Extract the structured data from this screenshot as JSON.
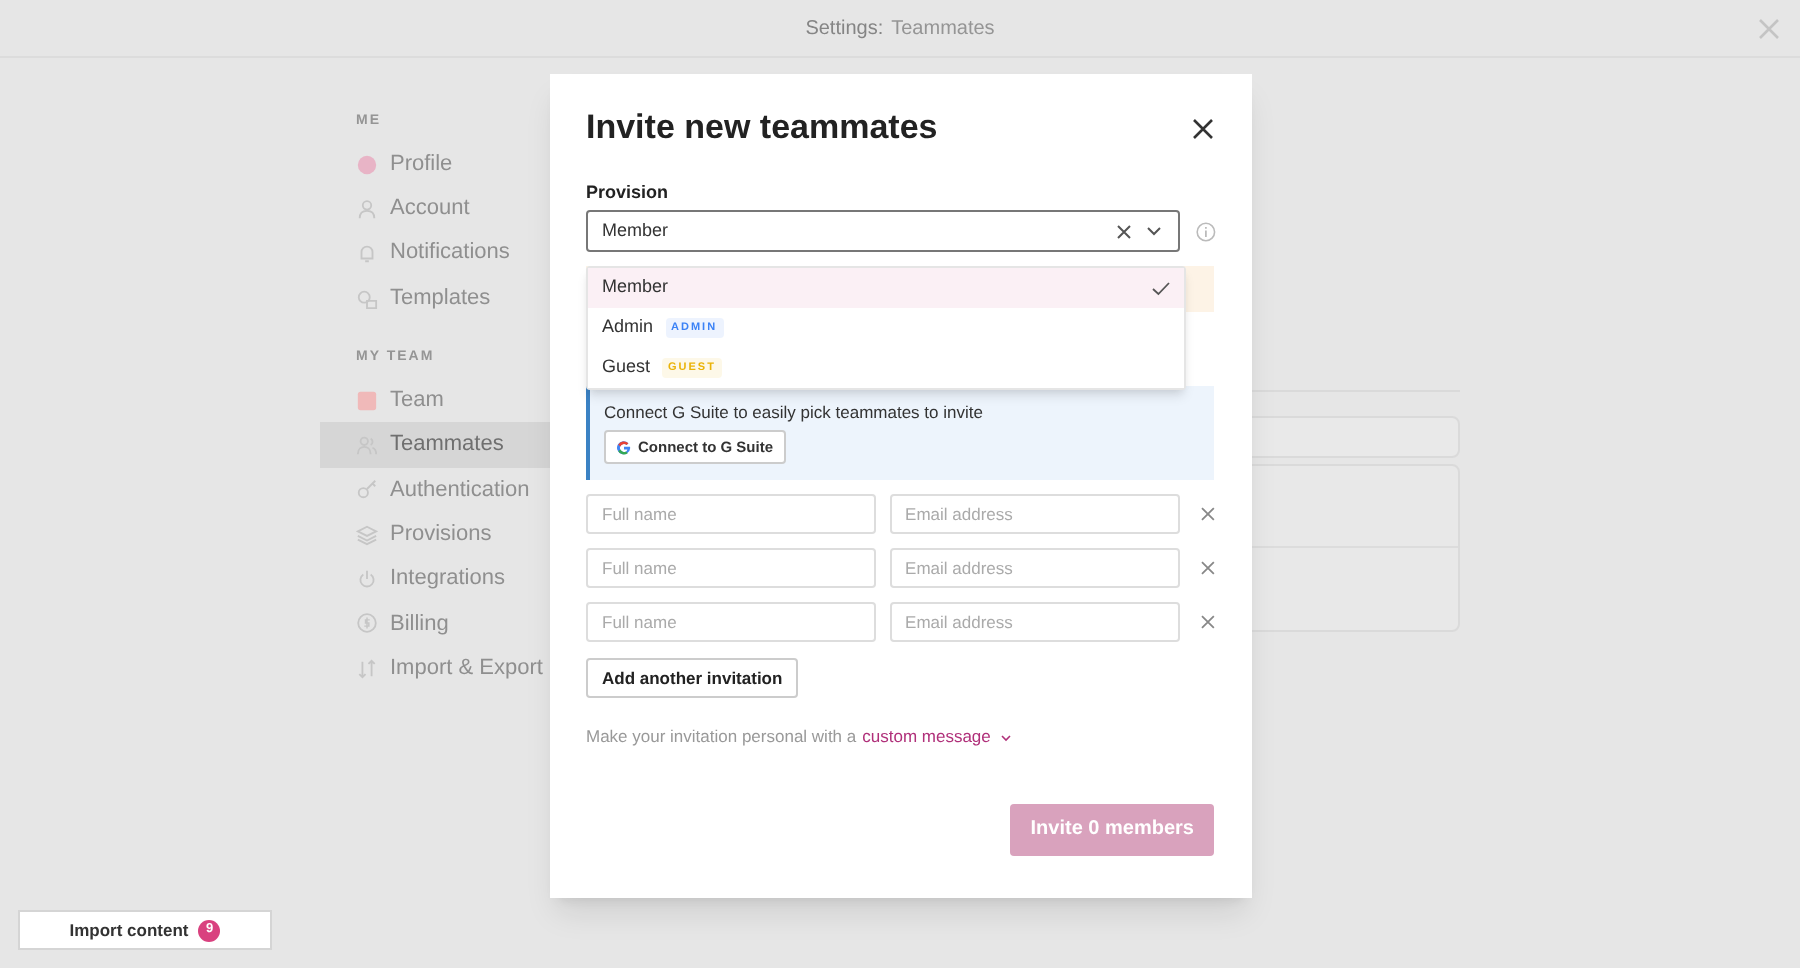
{
  "window": {
    "title_prefix": "Settings:",
    "title_page": "Teammates"
  },
  "sidebar": {
    "sections": [
      {
        "heading": "ME",
        "items": [
          {
            "label": "Profile",
            "kind": "avatar",
            "selected": false
          },
          {
            "label": "Account",
            "kind": "person",
            "selected": false
          },
          {
            "label": "Notifications",
            "kind": "bell",
            "selected": false
          },
          {
            "label": "Templates",
            "kind": "shapes",
            "selected": false
          }
        ]
      },
      {
        "heading": "MY TEAM",
        "items": [
          {
            "label": "Team",
            "kind": "team",
            "selected": false
          },
          {
            "label": "Teammates",
            "kind": "people",
            "selected": true
          },
          {
            "label": "Authentication",
            "kind": "key",
            "selected": false
          },
          {
            "label": "Provisions",
            "kind": "layers",
            "selected": false
          },
          {
            "label": "Integrations",
            "kind": "power",
            "selected": false
          },
          {
            "label": "Billing",
            "kind": "coin",
            "selected": false
          },
          {
            "label": "Import & Export",
            "kind": "arrows",
            "selected": false
          }
        ]
      }
    ]
  },
  "modal": {
    "title": "Invite new teammates",
    "provision": {
      "label": "Provision",
      "value": "Member",
      "expanded": true,
      "options": [
        {
          "label": "Member",
          "selected": true
        },
        {
          "label": "Admin",
          "badge": "ADMIN",
          "color": "#3b82f6",
          "selected": false
        },
        {
          "label": "Guest",
          "badge": "GUEST",
          "color": "#eab308",
          "selected": false
        }
      ]
    },
    "gsuite": {
      "text": "Connect G Suite to easily pick teammates to invite",
      "button": "Connect to G Suite"
    },
    "invitations": [
      {
        "name_placeholder": "Full name",
        "email_placeholder": "Email address"
      },
      {
        "name_placeholder": "Full name",
        "email_placeholder": "Email address"
      },
      {
        "name_placeholder": "Full name",
        "email_placeholder": "Email address"
      }
    ],
    "add_button": "Add another invitation",
    "personal": {
      "text": "Make your invitation personal with a",
      "link": "custom message"
    },
    "submit": {
      "label": "Invite 0 members",
      "disabled": true
    }
  },
  "import": {
    "label": "Import content",
    "count": "9"
  }
}
